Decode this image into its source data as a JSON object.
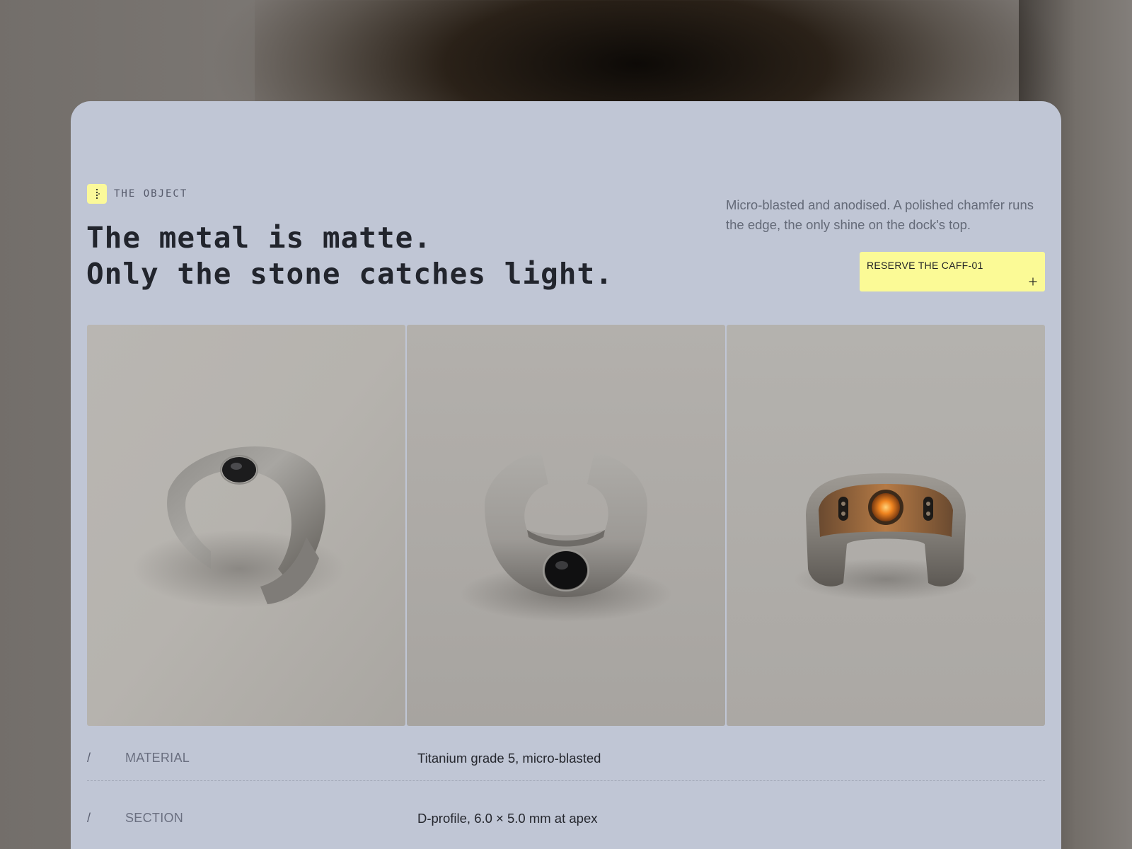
{
  "section": {
    "eyebrow": "THE OBJECT",
    "eyebrow_icon": "dot-column-icon",
    "headline": [
      "The metal is matte.",
      "Only the stone catches light."
    ],
    "intro": "Micro-blasted and anodised. A polished chamfer runs the edge, the only shine on the dock's top."
  },
  "cta": {
    "label": "RESERVE THE CAFF-01",
    "icon": "plus-icon"
  },
  "gallery": [
    {
      "name": "ring-photo-angle",
      "subject": "open titanium ring with black stone, angled view"
    },
    {
      "name": "ring-photo-front",
      "subject": "open titanium ring, stone facing front"
    },
    {
      "name": "ring-photo-inner",
      "subject": "open ring showing inner glowing sensor"
    }
  ],
  "specs": [
    {
      "marker": "/",
      "key": "MATERIAL",
      "value": "Titanium grade 5, micro-blasted"
    },
    {
      "marker": "/",
      "key": "SECTION",
      "value": "D-profile, 6.0 × 5.0 mm at apex"
    }
  ],
  "colors": {
    "card": "#c0c6d5",
    "accent": "#fbfa96",
    "text": "#22252d",
    "muted": "#646a78"
  }
}
